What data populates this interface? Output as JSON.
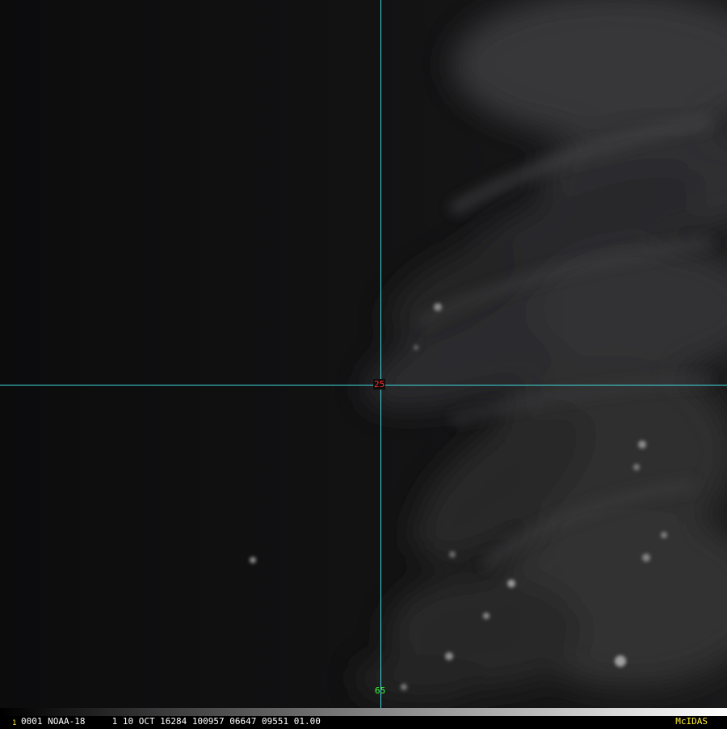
{
  "image": {
    "subject": "satellite-imagery",
    "colors": {
      "background": "#0e0e0f",
      "gridline": "#3fd7dd",
      "lat_label": "#ff2a2a",
      "lon_label": "#3dff3d",
      "caption_text": "#ffffff",
      "frame_number": "#ffee33",
      "brand": "#ffee33"
    }
  },
  "grid": {
    "lat_label": "25",
    "lon_label": "65"
  },
  "footer": {
    "frame_number": "1",
    "caption": "0001 NOAA-18     1 10 OCT 16284 100957 06647 09551 01.00",
    "brand": "McIDAS"
  }
}
